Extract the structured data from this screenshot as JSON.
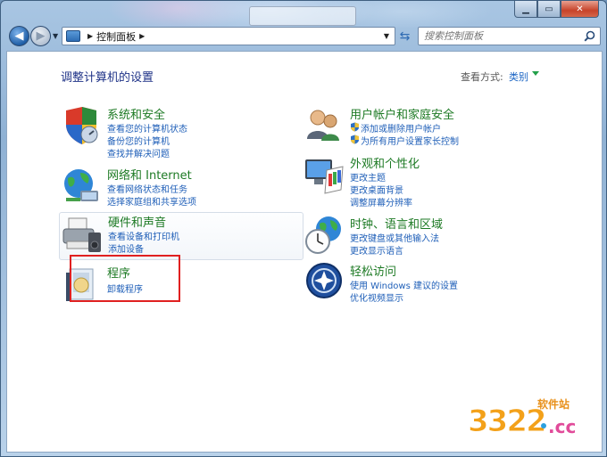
{
  "window": {
    "caption_buttons": [
      "minimize",
      "maximize",
      "close"
    ]
  },
  "nav": {
    "address_text": "控制面板",
    "search_placeholder": "搜索控制面板"
  },
  "header": {
    "title": "调整计算机的设置",
    "view_by_label": "查看方式:",
    "view_by_value": "类别"
  },
  "categories": [
    {
      "title": "系统和安全",
      "links": [
        "查看您的计算机状态",
        "备份您的计算机",
        "查找并解决问题"
      ]
    },
    {
      "title": "网络和 Internet",
      "links": [
        "查看网络状态和任务",
        "选择家庭组和共享选项"
      ]
    },
    {
      "title": "硬件和声音",
      "links": [
        "查看设备和打印机",
        "添加设备"
      ]
    },
    {
      "title": "程序",
      "links": [
        "卸载程序"
      ]
    },
    {
      "title": "用户帐户和家庭安全",
      "links": [
        "添加或删除用户帐户",
        "为所有用户设置家长控制"
      ]
    },
    {
      "title": "外观和个性化",
      "links": [
        "更改主题",
        "更改桌面背景",
        "调整屏幕分辨率"
      ]
    },
    {
      "title": "时钟、语言和区域",
      "links": [
        "更改键盘或其他输入法",
        "更改显示语言"
      ]
    },
    {
      "title": "轻松访问",
      "links": [
        "使用 Windows 建议的设置",
        "优化视频显示"
      ]
    }
  ],
  "watermark": {
    "number": "3322",
    "site": "软件站",
    "domain": ".cc"
  },
  "colors": {
    "category_title": "#1d7a24",
    "link": "#1f5fb8",
    "page_title": "#1e3287",
    "highlight": "#e02020"
  }
}
